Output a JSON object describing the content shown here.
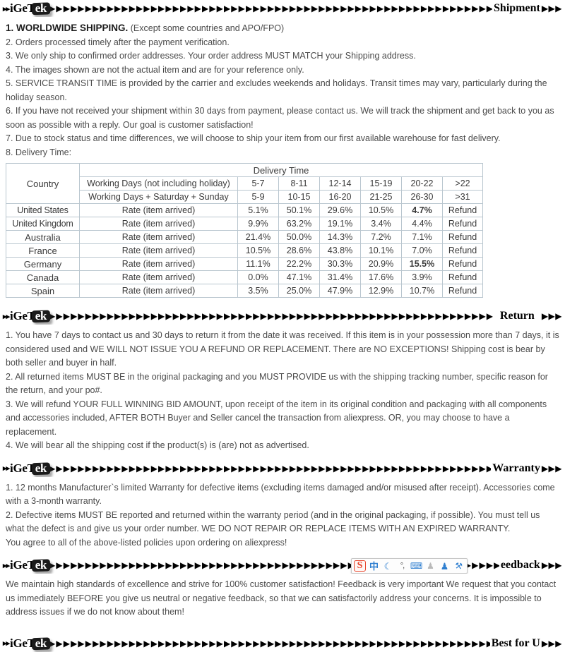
{
  "brand": {
    "prefix_arrows": "▸▸",
    "name_part1": "iGeT",
    "name_part2": "ek",
    "arrow_glyph": "▶"
  },
  "sections": {
    "shipment": {
      "title": "Shipment",
      "trailing_arrows": "▶▶▶",
      "leading_arrows": "▶▶▶",
      "lines": {
        "l1_bold": "1. WORLDWIDE SHIPPING.",
        "l1_rest": " (Except some countries and APO/FPO)",
        "l2": "2. Orders processed timely after the payment verification.",
        "l3": "3. We only ship to confirmed order addresses. Your order address MUST MATCH your Shipping address.",
        "l4": "4. The images shown are not the actual item and are for your reference only.",
        "l5": "5. SERVICE TRANSIT TIME is provided by the carrier and excludes weekends and holidays. Transit times may vary, particularly during the holiday season.",
        "l6": "6. If you have not received your shipment within 30 days from payment, please contact us. We will track the shipment and get back to you as soon as possible with a reply. Our goal is customer satisfaction!",
        "l7": "7. Due to stock status and time differences, we will choose to ship your item from our first available warehouse for fast delivery.",
        "l8": "8. Delivery Time:"
      }
    },
    "return": {
      "title": "Return",
      "trailing_arrows": "▶▶▶",
      "lines": {
        "l1": "1. You have 7 days to contact us and 30 days to return it from the date it was received. If this item is in your possession more than 7 days, it is considered used and WE WILL NOT ISSUE YOU A REFUND OR REPLACEMENT. There are NO EXCEPTIONS! Shipping cost is bear by both seller and buyer in half.",
        "l2": "2. All returned items MUST BE in the original packaging and you MUST PROVIDE us with the shipping tracking number, specific reason for the return, and your po#.",
        "l3": "3. We will refund YOUR FULL WINNING BID AMOUNT, upon receipt of the item in its original condition and packaging with all components and accessories included, AFTER BOTH Buyer and Seller cancel the transaction from aliexpress. OR, you may choose to have a replacement.",
        "l4": "4.  We will bear all the shipping cost if the product(s) is (are) not as advertised."
      }
    },
    "warranty": {
      "title": "Warranty",
      "trailing_arrows": "▶▶▶",
      "lines": {
        "l1": "1. 12 months Manufacturer`s limited Warranty for defective items (excluding items damaged and/or misused after receipt). Accessories come with a 3-month warranty.",
        "l2": "2. Defective items MUST BE reported and returned within the warranty period (and in the original packaging, if possible). You must tell us what the defect is and give us your order number. WE DO NOT REPAIR OR REPLACE ITEMS WITH AN EXPIRED WARRANTY.",
        "l3": "You agree to all of the above-listed policies upon ordering on aliexpress!"
      }
    },
    "feedback": {
      "title": "eedback",
      "trailing_arrows": "▶▶▶",
      "lines": {
        "l1": "We maintain high standards of excellence and strive for 100% customer satisfaction! Feedback is very important We request that you contact us immediately BEFORE you give us neutral or negative feedback, so that we can satisfactorily address your concerns. It is impossible to address issues if we do not know about them!"
      }
    },
    "best_for_u": {
      "title": "Best for U",
      "trailing_arrows": "▶▶▶"
    }
  },
  "ime_toolbar": {
    "icons": [
      {
        "name": "sogou-logo-icon",
        "glyph": "S",
        "class": "sogou"
      },
      {
        "name": "chinese-mode-icon",
        "glyph": "中",
        "class": "cn"
      },
      {
        "name": "moon-icon",
        "glyph": "☾",
        "class": "moon"
      },
      {
        "name": "punctuation-icon",
        "glyph": "°,",
        "class": "punct"
      },
      {
        "name": "keyboard-icon",
        "glyph": "⌨",
        "class": "kbd"
      },
      {
        "name": "person-icon",
        "glyph": "♟",
        "class": "person"
      },
      {
        "name": "skin-shirt-icon",
        "glyph": "♟",
        "class": "shirt"
      },
      {
        "name": "wrench-settings-icon",
        "glyph": "⚒",
        "class": "wrench"
      }
    ]
  },
  "delivery_table": {
    "caption": "Delivery Time",
    "country_header": "Country",
    "row_labels": {
      "working_days": "Working Days (not including holiday)",
      "working_days_weekend": "Working Days + Saturday + Sunday",
      "rate": "Rate (item arrived)"
    },
    "buckets_working": [
      "5-7",
      "8-11",
      "12-14",
      "15-19",
      "20-22",
      ">22"
    ],
    "buckets_total": [
      "5-9",
      "10-15",
      "16-20",
      "21-25",
      "26-30",
      ">31"
    ],
    "rows": [
      {
        "country": "United States",
        "values": [
          "5.1%",
          "50.1%",
          "29.6%",
          "10.5%",
          "4.7%",
          "Refund"
        ]
      },
      {
        "country": "United Kingdom",
        "values": [
          "9.9%",
          "63.2%",
          "19.1%",
          "3.4%",
          "4.4%",
          "Refund"
        ]
      },
      {
        "country": "Australia",
        "values": [
          "21.4%",
          "50.0%",
          "14.3%",
          "7.2%",
          "7.1%",
          "Refund"
        ]
      },
      {
        "country": "France",
        "values": [
          "10.5%",
          "28.6%",
          "43.8%",
          "10.1%",
          "7.0%",
          "Refund"
        ]
      },
      {
        "country": "Germany",
        "values": [
          "11.1%",
          "22.2%",
          "30.3%",
          "20.9%",
          "15.5%",
          "Refund"
        ]
      },
      {
        "country": "Canada",
        "values": [
          "0.0%",
          "47.1%",
          "31.4%",
          "17.6%",
          "3.9%",
          "Refund"
        ]
      },
      {
        "country": "Spain",
        "values": [
          "3.5%",
          "25.0%",
          "47.9%",
          "12.9%",
          "10.7%",
          "Refund"
        ]
      }
    ]
  }
}
